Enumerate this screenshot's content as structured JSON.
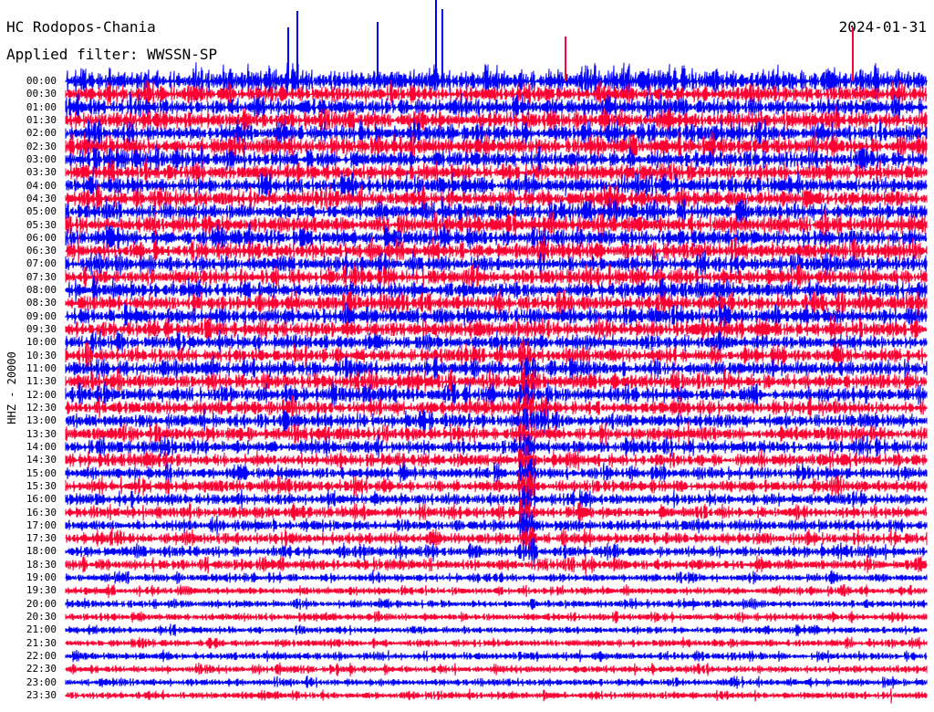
{
  "header": {
    "station": "HC Rodopos-Chania",
    "filter": "Applied filter: WWSSN-SP",
    "date": "2024-01-31"
  },
  "colors": {
    "trace_a": "#0000ff",
    "trace_b": "#ff0033",
    "background": "#ffffff",
    "text": "#000000"
  },
  "chart_data": {
    "type": "helicorder",
    "ylabel": "HHZ - 20000",
    "row_labels": [
      "00:00",
      "00:30",
      "01:00",
      "01:30",
      "02:00",
      "02:30",
      "03:00",
      "03:30",
      "04:00",
      "04:30",
      "05:00",
      "05:30",
      "06:00",
      "06:30",
      "07:00",
      "07:30",
      "08:00",
      "08:30",
      "09:00",
      "09:30",
      "10:00",
      "10:30",
      "11:00",
      "11:30",
      "12:00",
      "12:30",
      "13:00",
      "13:30",
      "14:00",
      "14:30",
      "15:00",
      "15:30",
      "16:00",
      "16:30",
      "17:00",
      "17:30",
      "18:00",
      "18:30",
      "19:00",
      "19:30",
      "20:00",
      "20:30",
      "21:00",
      "21:30",
      "22:00",
      "22:30",
      "23:00",
      "23:30"
    ],
    "row_minutes": 30,
    "alternating_colors": [
      "blue",
      "red"
    ],
    "noise_level": [
      1.0,
      1.0,
      1.0,
      1.0,
      1.0,
      1.0,
      1.0,
      1.0,
      1.0,
      1.0,
      1.0,
      1.0,
      1.0,
      1.0,
      0.95,
      0.95,
      0.95,
      0.95,
      0.95,
      0.95,
      0.9,
      0.9,
      0.9,
      0.9,
      0.9,
      0.85,
      0.85,
      0.85,
      0.8,
      0.8,
      0.75,
      0.75,
      0.7,
      0.7,
      0.7,
      0.7,
      0.65,
      0.65,
      0.5,
      0.45,
      0.45,
      0.45,
      0.45,
      0.45,
      0.45,
      0.45,
      0.45,
      0.45
    ],
    "event": {
      "start_row": "10:30",
      "end_row": "18:00",
      "x_fraction": 0.535,
      "label": ""
    }
  }
}
